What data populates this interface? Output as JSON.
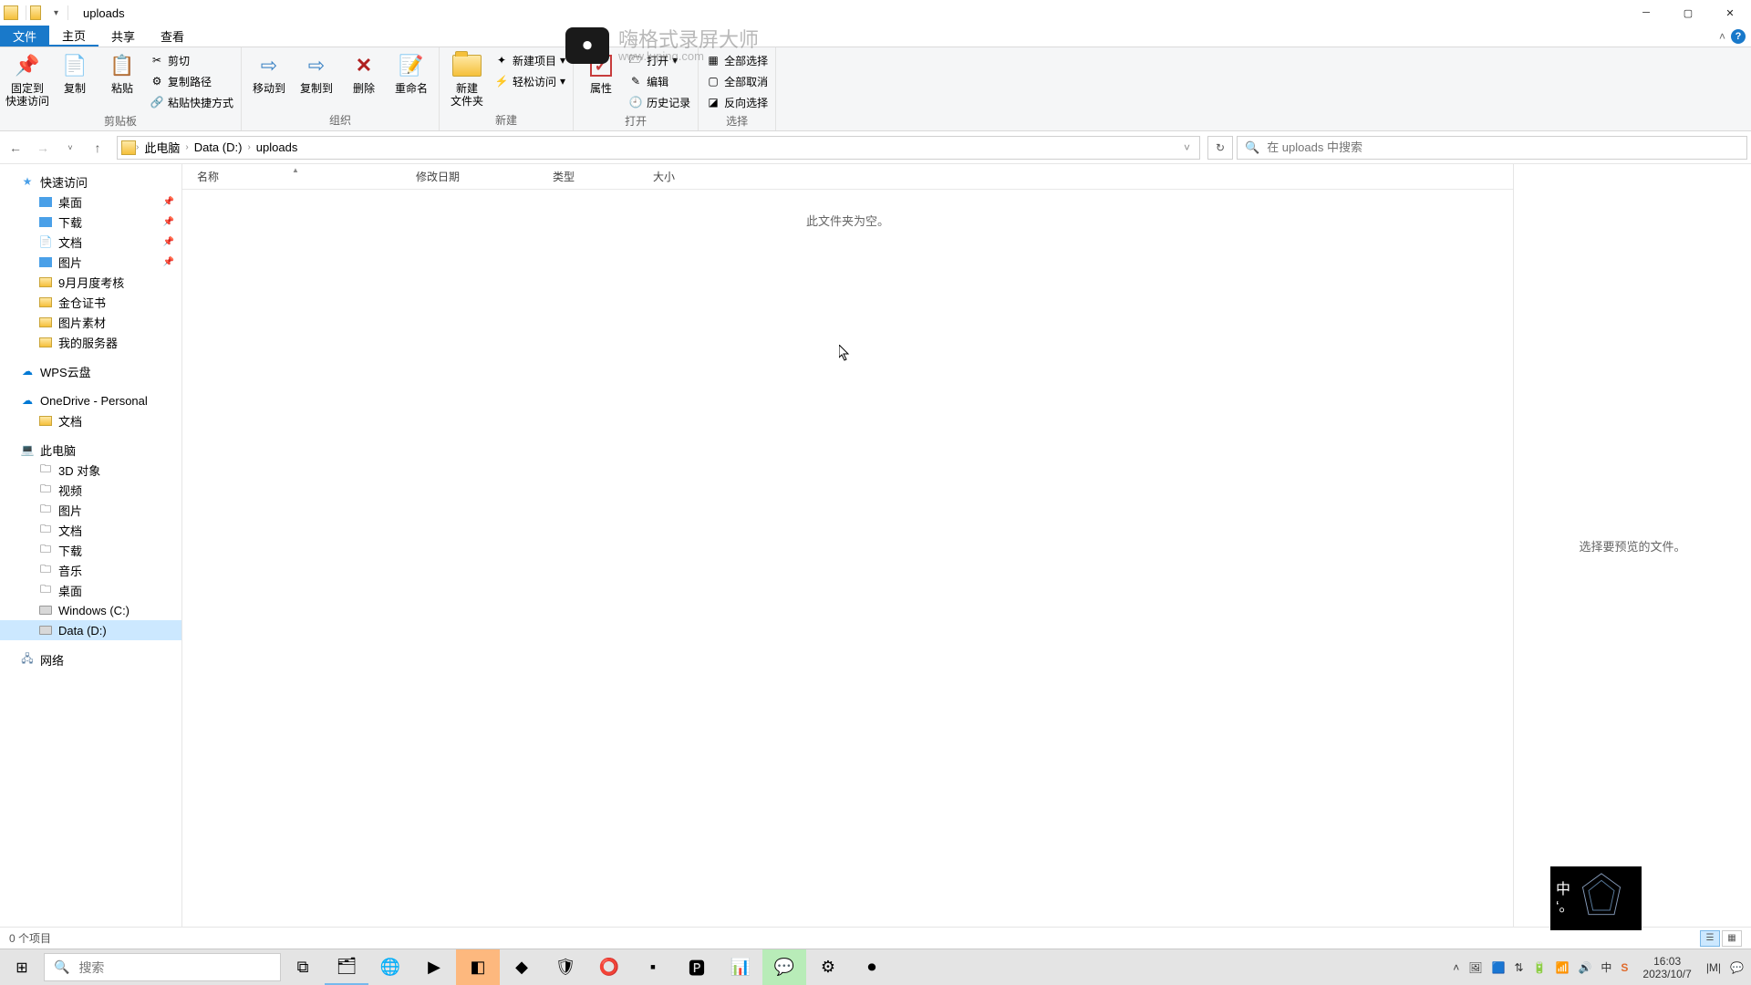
{
  "window": {
    "title": "uploads"
  },
  "tabs": {
    "file": "文件",
    "home": "主页",
    "share": "共享",
    "view": "查看"
  },
  "ribbon": {
    "clipboard": {
      "pin": "固定到\n快速访问",
      "copy": "复制",
      "paste": "粘贴",
      "cut": "剪切",
      "copy_path": "复制路径",
      "paste_shortcut": "粘贴快捷方式",
      "label": "剪贴板"
    },
    "organize": {
      "move_to": "移动到",
      "copy_to": "复制到",
      "delete": "删除",
      "rename": "重命名",
      "label": "组织"
    },
    "new": {
      "new_folder": "新建\n文件夹",
      "new_item": "新建项目",
      "easy_access": "轻松访问",
      "label": "新建"
    },
    "open": {
      "properties": "属性",
      "open": "打开",
      "edit": "编辑",
      "history": "历史记录",
      "label": "打开"
    },
    "select": {
      "select_all": "全部选择",
      "select_none": "全部取消",
      "invert": "反向选择",
      "label": "选择"
    }
  },
  "breadcrumb": {
    "pc": "此电脑",
    "drive": "Data (D:)",
    "folder": "uploads"
  },
  "search": {
    "placeholder": "在 uploads 中搜索"
  },
  "columns": {
    "name": "名称",
    "date": "修改日期",
    "type": "类型",
    "size": "大小"
  },
  "content": {
    "empty": "此文件夹为空。"
  },
  "preview": {
    "msg": "选择要预览的文件。"
  },
  "nav": {
    "quick_access": "快速访问",
    "qa_items": [
      {
        "label": "桌面",
        "pin": true,
        "icon": "blue"
      },
      {
        "label": "下载",
        "pin": true,
        "icon": "blue"
      },
      {
        "label": "文档",
        "pin": true,
        "icon": "doc"
      },
      {
        "label": "图片",
        "pin": true,
        "icon": "blue"
      },
      {
        "label": "9月月度考核",
        "pin": false,
        "icon": "folder"
      },
      {
        "label": "金仓证书",
        "pin": false,
        "icon": "folder"
      },
      {
        "label": "图片素材",
        "pin": false,
        "icon": "folder"
      },
      {
        "label": "我的服务器",
        "pin": false,
        "icon": "folder"
      }
    ],
    "wps": "WPS云盘",
    "onedrive": "OneDrive - Personal",
    "od_items": [
      {
        "label": "文档"
      }
    ],
    "this_pc": "此电脑",
    "pc_items": [
      {
        "label": "3D 对象"
      },
      {
        "label": "视频"
      },
      {
        "label": "图片"
      },
      {
        "label": "文档"
      },
      {
        "label": "下载"
      },
      {
        "label": "音乐"
      },
      {
        "label": "桌面"
      },
      {
        "label": "Windows (C:)"
      },
      {
        "label": "Data (D:)",
        "selected": true
      }
    ],
    "network": "网络"
  },
  "status": {
    "count": "0 个项目"
  },
  "taskbar": {
    "search": "搜索",
    "time": "16:03",
    "date": "2023/10/7"
  },
  "watermark": {
    "line1": "嗨格式录屏大师",
    "line2": "www.luping.com"
  },
  "ime": {
    "lang": "中",
    "punct": "‘。"
  }
}
